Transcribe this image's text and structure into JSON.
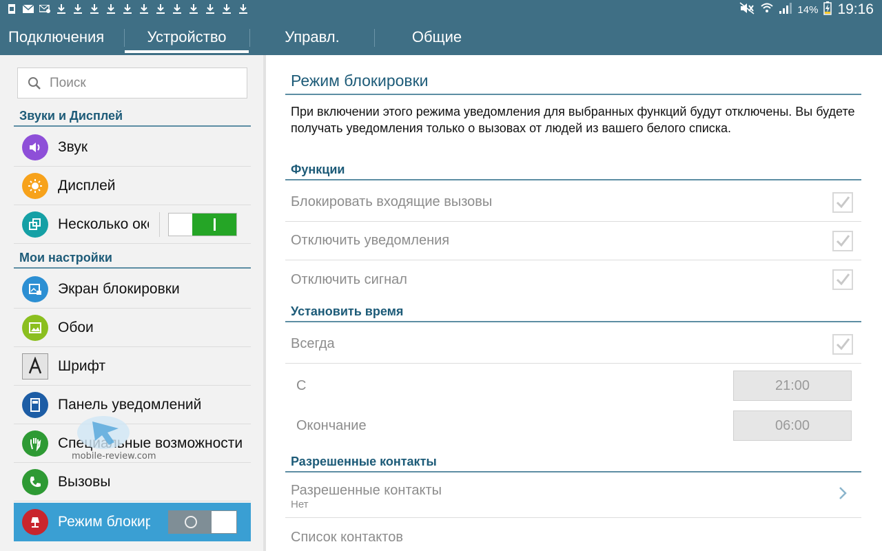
{
  "statusbar": {
    "left_icons": [
      "sim-icon",
      "mail-icon",
      "mail-alert-icon",
      "download-icon",
      "download-icon",
      "download-icon",
      "download-icon",
      "download-icon",
      "download-icon",
      "download-icon",
      "download-icon",
      "download-icon",
      "download-icon",
      "download-icon",
      "download-icon"
    ],
    "battery": "14%",
    "time": "19:16"
  },
  "tabs": [
    {
      "label": "Подключения"
    },
    {
      "label": "Устройство",
      "selected": true
    },
    {
      "label": "Управл."
    },
    {
      "label": "Общие"
    }
  ],
  "sidebar": {
    "search_placeholder": "Поиск",
    "sections": [
      {
        "title": "Звуки и Дисплей"
      },
      {
        "title": "Мои настройки"
      }
    ],
    "items": [
      {
        "label": "Звук",
        "icon": "sound-icon",
        "color": "#8e4fd8"
      },
      {
        "label": "Дисплей",
        "icon": "brightness-icon",
        "color": "#f7a21b"
      },
      {
        "label": "Несколько окон",
        "icon": "multiwindow-icon",
        "color": "#15a0a5",
        "toggle": true
      },
      {
        "label": "Экран блокировки",
        "icon": "lockscreen-icon",
        "color": "#2c8fd3"
      },
      {
        "label": "Обои",
        "icon": "wallpaper-icon",
        "color": "#8bbf1f"
      },
      {
        "label": "Шрифт",
        "icon": "font-icon",
        "color": "#bdbdbd"
      },
      {
        "label": "Панель уведомлений",
        "icon": "notification-panel-icon",
        "color": "#1d5da5"
      },
      {
        "label": "Специальные возможности",
        "icon": "accessibility-hand-icon",
        "color": "#2e9a34"
      },
      {
        "label": "Вызовы",
        "icon": "phone-icon",
        "color": "#2e9a34"
      },
      {
        "label": "Режим блокировки",
        "icon": "blocking-mode-icon",
        "color": "#c9252d",
        "toggle": false,
        "active": true
      }
    ]
  },
  "detail": {
    "title": "Режим блокировки",
    "description": "При включении этого режима уведомления для выбранных функций будут отключены. Вы будете получать уведомления только о вызовах от людей из вашего белого списка.",
    "sections": {
      "functions": "Функции",
      "set_time": "Установить время",
      "allowed_contacts": "Разрешенные контакты"
    },
    "functions": [
      {
        "label": "Блокировать входящие вызовы",
        "checked": true
      },
      {
        "label": "Отключить уведомления",
        "checked": true
      },
      {
        "label": "Отключить сигнал",
        "checked": true
      }
    ],
    "always": {
      "label": "Всегда",
      "checked": true
    },
    "from": {
      "label": "С",
      "value": "21:00"
    },
    "to": {
      "label": "Окончание",
      "value": "06:00"
    },
    "allowed": {
      "label": "Разрешенные контакты",
      "value": "Нет"
    },
    "contact_list": "Список контактов"
  },
  "watermark": "mobile-review.com",
  "colors": {
    "header_bg": "#3f6f85",
    "accent_text": "#1d5b78",
    "active_item_bg": "#3a9fd3",
    "toggle_on": "#25a526"
  }
}
